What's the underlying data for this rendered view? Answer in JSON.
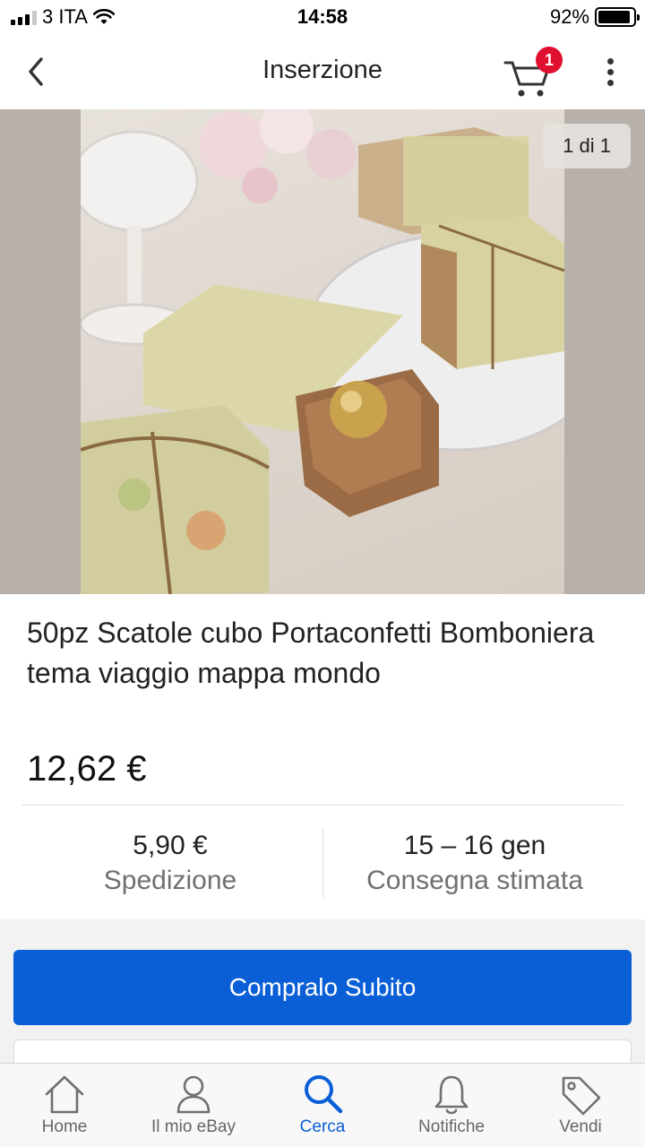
{
  "status_bar": {
    "carrier": "3 ITA",
    "time": "14:58",
    "battery": "92%",
    "battery_level": 0.92
  },
  "nav": {
    "title": "Inserzione",
    "cart_count": "1",
    "icons": [
      "back-chevron-icon",
      "cart-icon",
      "more-vertical-icon"
    ]
  },
  "gallery": {
    "counter": "1 di 1"
  },
  "product": {
    "title": "50pz Scatole cubo Portaconfetti Bomboniera tema viaggio mappa mondo",
    "price": "12,62 €"
  },
  "shipping": {
    "value": "5,90 €",
    "label": "Spedizione"
  },
  "delivery": {
    "value": "15 – 16 gen",
    "label": "Consegna stimata"
  },
  "buy_button": {
    "label": "Compralo Subito"
  },
  "colors": {
    "accent": "#0a5fd6",
    "badge": "#e0102f"
  },
  "tabs": [
    {
      "label": "Home",
      "icon": "home-icon"
    },
    {
      "label": "Il mio eBay",
      "icon": "user-icon"
    },
    {
      "label": "Cerca",
      "icon": "search-icon",
      "active": true
    },
    {
      "label": "Notifiche",
      "icon": "bell-icon"
    },
    {
      "label": "Vendi",
      "icon": "tag-icon"
    }
  ]
}
